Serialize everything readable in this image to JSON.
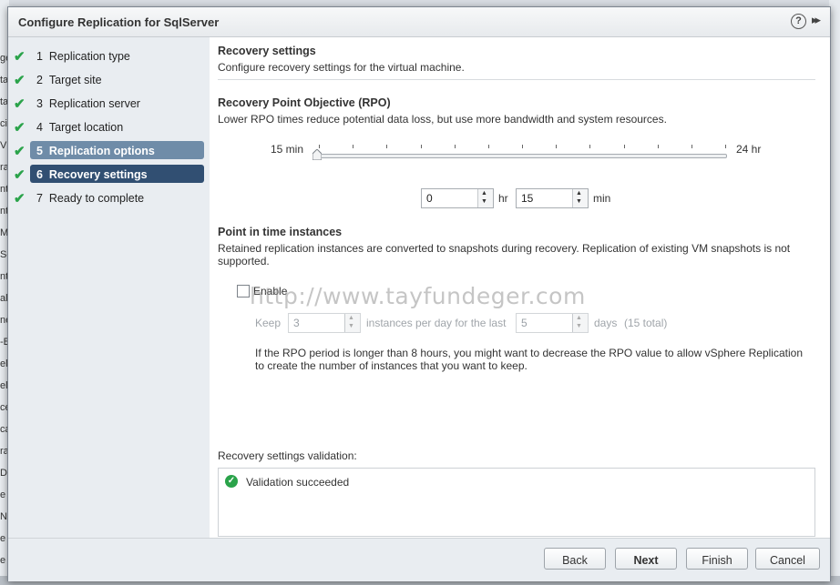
{
  "dialog": {
    "title": "Configure Replication for SqlServer",
    "help_glyph": "?",
    "expand_glyph": "▸▸"
  },
  "steps": [
    {
      "num": "1",
      "label": "Replication type",
      "state": "completed"
    },
    {
      "num": "2",
      "label": "Target site",
      "state": "completed"
    },
    {
      "num": "3",
      "label": "Replication server",
      "state": "completed"
    },
    {
      "num": "4",
      "label": "Target location",
      "state": "completed"
    },
    {
      "num": "5",
      "label": "Replication options",
      "state": "visited"
    },
    {
      "num": "6",
      "label": "Recovery settings",
      "state": "current"
    },
    {
      "num": "7",
      "label": "Ready to complete",
      "state": "completed"
    }
  ],
  "page": {
    "heading": "Recovery settings",
    "subheading": "Configure recovery settings for the virtual machine."
  },
  "rpo": {
    "title": "Recovery Point Objective (RPO)",
    "description": "Lower RPO times reduce potential data loss, but use more bandwidth and system resources.",
    "slider_min_label": "15 min",
    "slider_max_label": "24 hr",
    "slider_value_fraction": 0.0,
    "hours_value": "0",
    "hours_unit": "hr",
    "minutes_value": "15",
    "minutes_unit": "min"
  },
  "pit": {
    "title": "Point in time instances",
    "description_line1": "Retained replication instances are converted to snapshots during recovery. Replication of existing VM snapshots is not",
    "description_line2": "supported.",
    "enable_label": "Enable",
    "enable_checked": false,
    "keep_label": "Keep",
    "keep_value": "3",
    "per_day_label": "instances per day for the last",
    "days_value": "5",
    "days_label": "days",
    "total_label": "(15 total)",
    "note_line1": "If the RPO period is longer than 8 hours, you might want to decrease the RPO value to allow vSphere Replication",
    "note_line2": "to create the number of instances that you want to keep."
  },
  "watermark": "http://www.tayfundeger.com",
  "validation": {
    "label": "Recovery settings validation:",
    "message": "Validation succeeded",
    "status_color": "#2aa34a"
  },
  "buttons": {
    "back": "Back",
    "next": "Next",
    "finish": "Finish",
    "cancel": "Cancel"
  },
  "background_fragments": [
    "ge",
    "ta",
    "ta",
    "ci",
    "V",
    "ra",
    "nt",
    "nt",
    "M",
    "Se",
    "nt",
    "al",
    "ne",
    "-B",
    "el",
    "el",
    "ce",
    "ca",
    "ra",
    "D",
    "e",
    "N",
    "e",
    "e"
  ]
}
